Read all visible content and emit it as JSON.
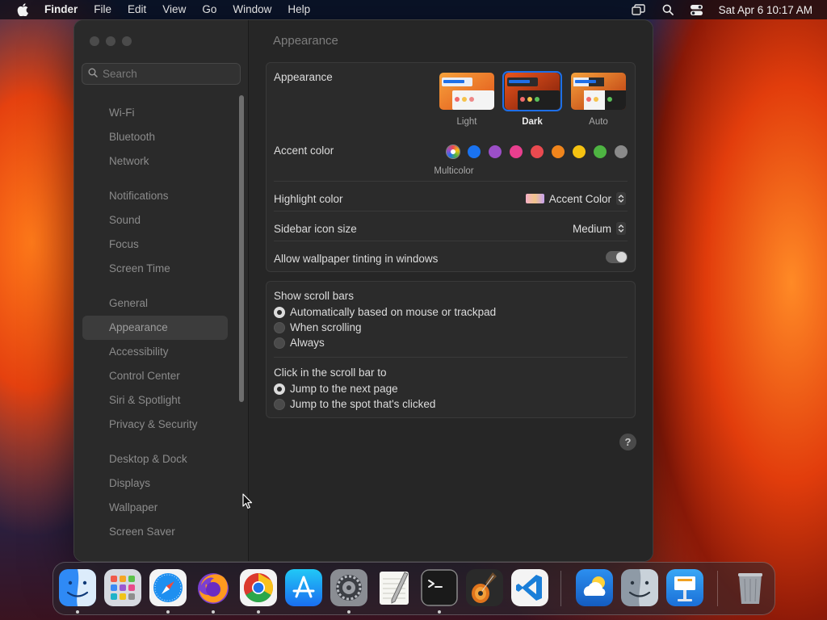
{
  "menubar": {
    "app_name": "Finder",
    "menus": [
      "File",
      "Edit",
      "View",
      "Go",
      "Window",
      "Help"
    ],
    "clock": "Sat Apr 6  10:17 AM"
  },
  "window": {
    "search_placeholder": "Search",
    "sidebar": {
      "groups": [
        [
          "Wi-Fi",
          "Bluetooth",
          "Network"
        ],
        [
          "Notifications",
          "Sound",
          "Focus",
          "Screen Time"
        ],
        [
          "General",
          "Appearance",
          "Accessibility",
          "Control Center",
          "Siri & Spotlight",
          "Privacy & Security"
        ],
        [
          "Desktop & Dock",
          "Displays",
          "Wallpaper",
          "Screen Saver"
        ]
      ],
      "selected": "Appearance"
    },
    "title": "Appearance",
    "appearance": {
      "label": "Appearance",
      "options": [
        "Light",
        "Dark",
        "Auto"
      ],
      "selected": "Dark"
    },
    "accent": {
      "label": "Accent color",
      "colors": [
        "#5a5a5a",
        "#1a73f0",
        "#9b4fc7",
        "#e83f8e",
        "#ea4a50",
        "#f0851c",
        "#f5c211",
        "#4eb442",
        "#8a8a8a"
      ],
      "selected_caption": "Multicolor"
    },
    "highlight": {
      "label": "Highlight color",
      "value": "Accent Color"
    },
    "sidebar_icon_size": {
      "label": "Sidebar icon size",
      "value": "Medium"
    },
    "wallpaper_tinting": {
      "label": "Allow wallpaper tinting in windows"
    },
    "scroll_bars": {
      "label": "Show scroll bars",
      "options": [
        "Automatically based on mouse or trackpad",
        "When scrolling",
        "Always"
      ],
      "selected": 0
    },
    "click_scroll": {
      "label": "Click in the scroll bar to",
      "options": [
        "Jump to the next page",
        "Jump to the spot that's clicked"
      ],
      "selected": 0
    },
    "help_label": "?"
  },
  "dock": {
    "apps": [
      "finder-icon",
      "launchpad-icon",
      "safari-icon",
      "firefox-icon",
      "chrome-icon",
      "app-store-icon",
      "system-settings-icon",
      "textedit-icon",
      "terminal-icon",
      "garageband-icon",
      "vscode-icon",
      "weather-icon",
      "finder-icon",
      "keynote-icon",
      "trash-icon"
    ]
  }
}
